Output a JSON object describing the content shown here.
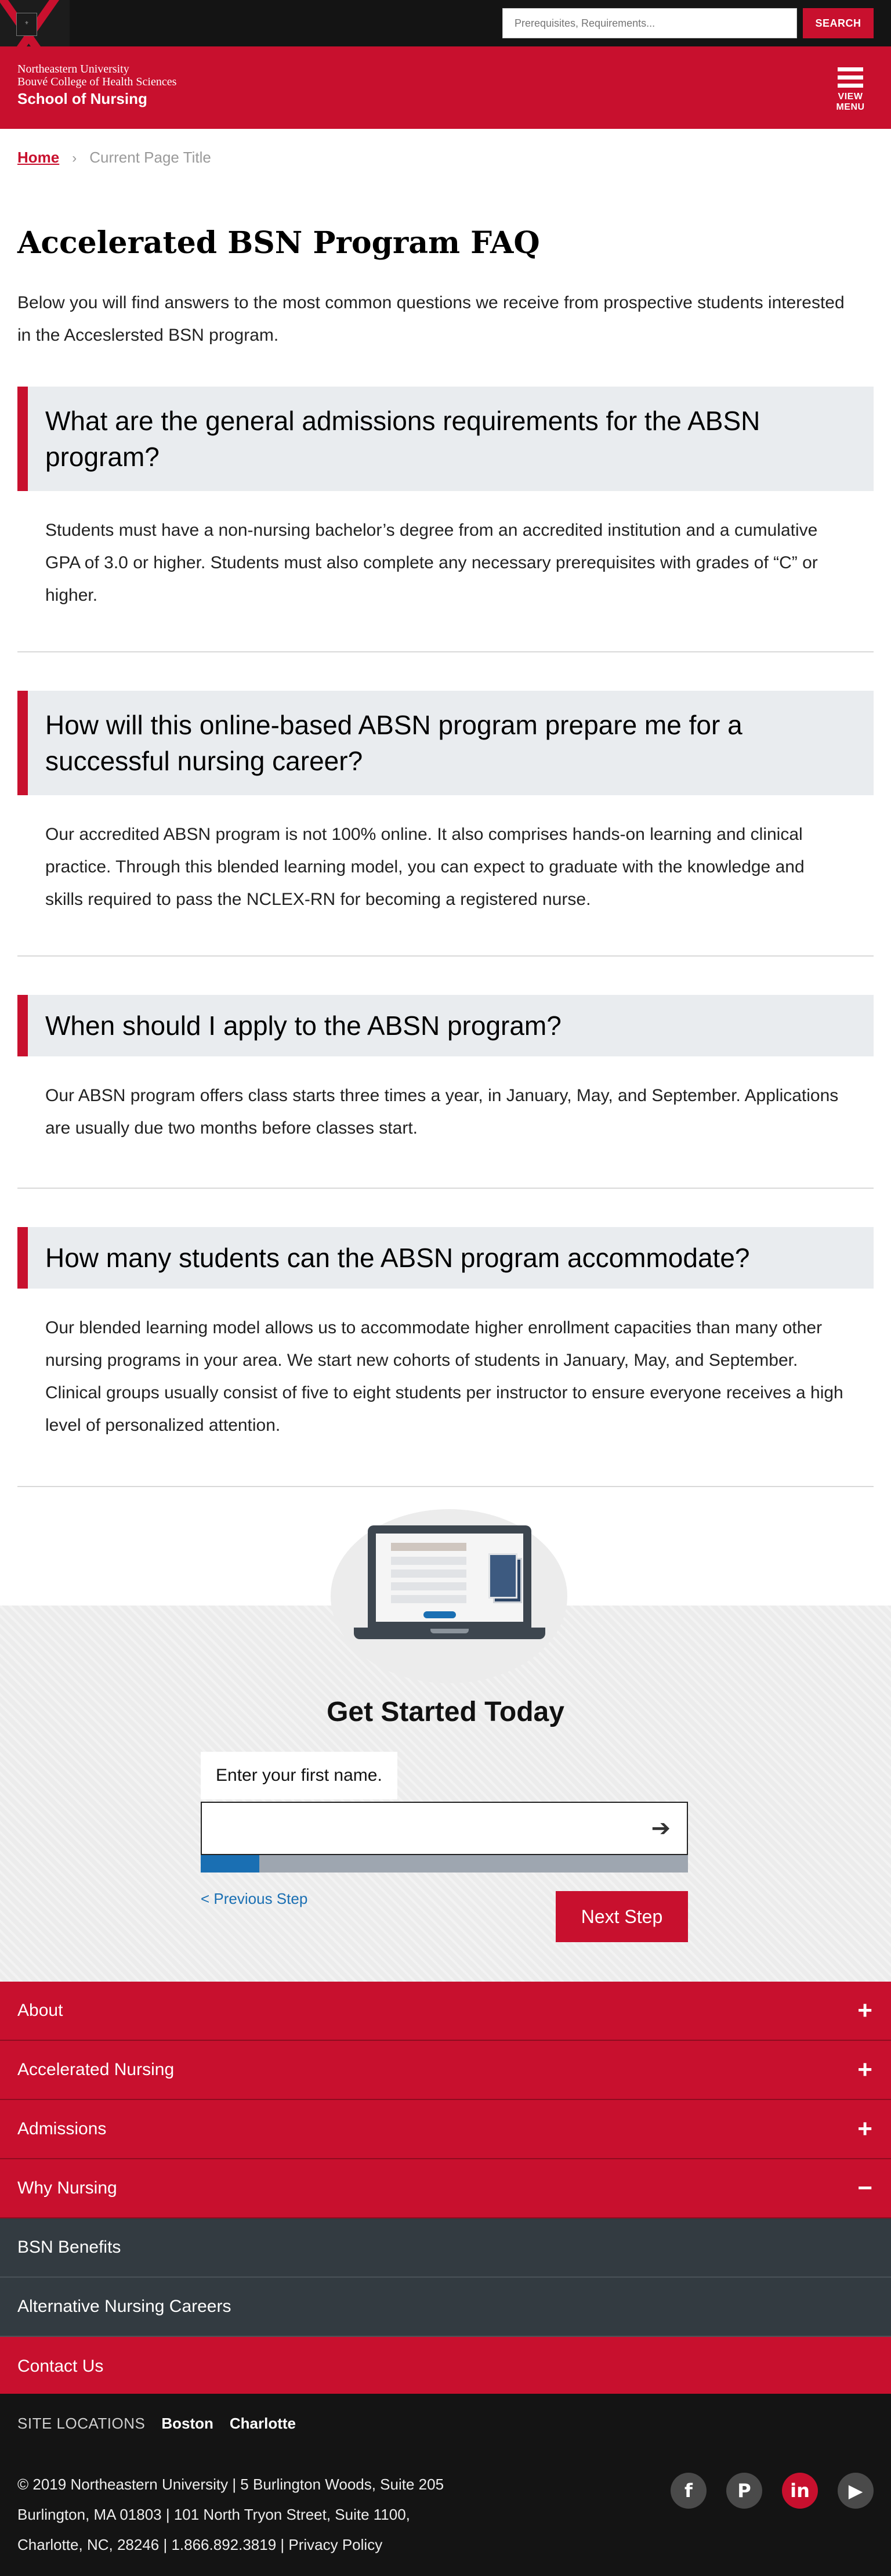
{
  "topbar": {
    "search_placeholder": "Prerequisites, Requirements...",
    "search_button": "SEARCH"
  },
  "header": {
    "line1": "Northeastern University",
    "line2": "Bouvé College of Health Sciences",
    "line3": "School of Nursing",
    "menu_label": "VIEW MENU"
  },
  "breadcrumb": {
    "home": "Home",
    "current": "Current Page Title"
  },
  "page": {
    "title": "Accelerated BSN Program FAQ",
    "intro": "Below you will find answers to the most common questions we receive from prospective students interested in the Acceslersted BSN program."
  },
  "faqs": [
    {
      "q": "What are the general admissions requirements for the ABSN program?",
      "a": "Students must have a non-nursing bachelor’s degree from an accredited institution and a cumulative GPA of 3.0 or higher. Students must also complete any necessary prerequisites with grades of “C” or higher."
    },
    {
      "q": "How will this online-based ABSN program prepare me for a successful nursing career?",
      "a": "Our accredited ABSN program is not 100% online. It also comprises hands-on learning and clinical practice. Through this blended learning model, you can expect to graduate with the knowledge and skills required to pass the NCLEX-RN for becoming a registered nurse."
    },
    {
      "q": "When should I apply to the ABSN program?",
      "a": "Our ABSN program offers class starts three times a year, in January, May, and September. Applications are usually due two months before classes start."
    },
    {
      "q": "How many students can the ABSN program accommodate?",
      "a": "Our blended learning model allows us to accommodate higher enrollment capacities than many other nursing programs in your area. We start new cohorts of students in January, May, and September. Clinical groups usually consist of five to eight students per instructor to ensure everyone receives a high level of personalized attention."
    }
  ],
  "get_started": {
    "title": "Get Started Today",
    "field_label": "Enter your first name.",
    "progress_fraction": 0.12,
    "prev_link": "< Previous Step",
    "next_button": "Next Step"
  },
  "footer_nav": {
    "items": [
      {
        "label": "About",
        "symbol": "+"
      },
      {
        "label": "Accelerated Nursing",
        "symbol": "+"
      },
      {
        "label": "Admissions",
        "symbol": "+"
      },
      {
        "label": "Why Nursing",
        "symbol": "−"
      }
    ],
    "sub_items": [
      "BSN Benefits",
      "Alternative Nursing Careers"
    ],
    "contact": "Contact Us"
  },
  "footer": {
    "locations_label": "SITE LOCATIONS",
    "locations": [
      "Boston",
      "Charlotte"
    ],
    "address_lines": [
      "© 2019 Northeastern University | 5 Burlington Woods, Suite 205",
      "Burlington, MA 01803 | 101 North Tryon Street, Suite 1100,",
      "Charlotte, NC, 28246 | 1.866.892.3819 | Privacy Policy"
    ],
    "social": [
      "facebook-icon",
      "pinterest-icon",
      "linkedin-icon",
      "youtube-icon"
    ]
  },
  "colors": {
    "brand_red": "#c8102e",
    "dark": "#141414",
    "slate": "#333b41",
    "link_blue": "#1a6fb3",
    "faq_bg": "#e9ecef"
  }
}
